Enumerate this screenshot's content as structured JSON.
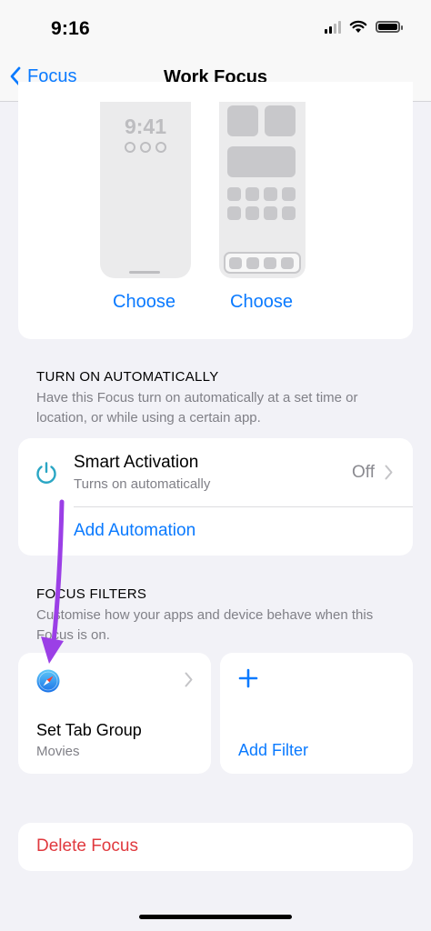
{
  "status_bar": {
    "time": "9:16"
  },
  "nav": {
    "back_label": "Focus",
    "title": "Work Focus"
  },
  "preview": {
    "lock_time": "9:41",
    "choose_lock": "Choose",
    "choose_home": "Choose"
  },
  "automation": {
    "header": "TURN ON AUTOMATICALLY",
    "description": "Have this Focus turn on automatically at a set time or location, or while using a certain app.",
    "smart_title": "Smart Activation",
    "smart_subtitle": "Turns on automatically",
    "smart_value": "Off",
    "add_label": "Add Automation"
  },
  "filters": {
    "header": "FOCUS FILTERS",
    "description": "Customise how your apps and device behave when this Focus is on.",
    "items": [
      {
        "title": "Set Tab Group",
        "subtitle": "Movies",
        "icon": "safari-icon"
      }
    ],
    "add_label": "Add Filter"
  },
  "delete_label": "Delete Focus",
  "colors": {
    "accent": "#0a7aff",
    "destructive": "#e0393e",
    "annotation_arrow": "#9b3fe6"
  }
}
